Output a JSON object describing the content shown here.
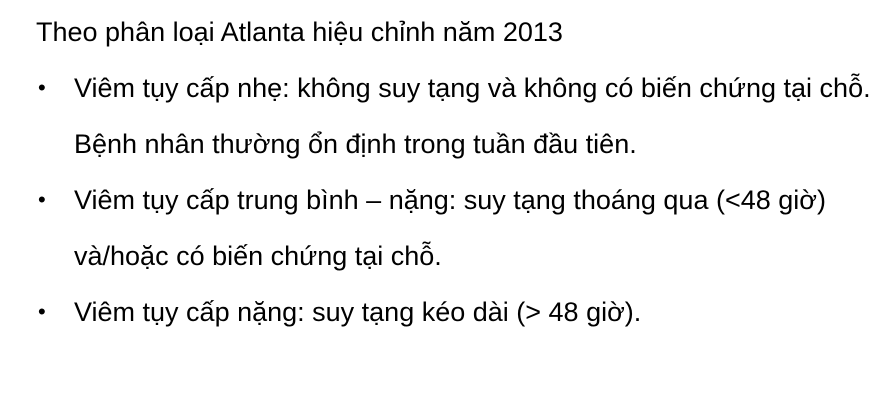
{
  "heading": "Theo phân loại Atlanta hiệu chỉnh năm 2013",
  "bullet_symbol": "•",
  "items": [
    {
      "text": "Viêm tụy cấp nhẹ: không suy tạng và không có biến chứng tại chỗ. Bệnh nhân thường ổn định trong tuần đầu tiên."
    },
    {
      "text": "Viêm tụy cấp trung bình – nặng: suy tạng thoáng qua (<48 giờ) và/hoặc có biến chứng tại chỗ."
    },
    {
      "text": "Viêm tụy cấp nặng: suy tạng kéo dài (> 48 giờ)."
    }
  ]
}
